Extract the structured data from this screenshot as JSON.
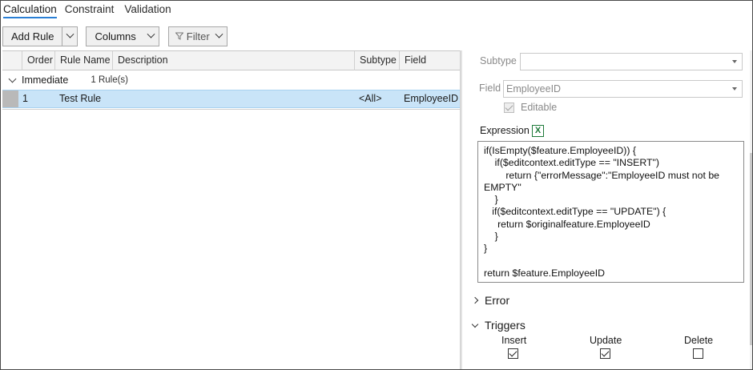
{
  "tabs": [
    {
      "label": "Calculation",
      "active": true
    },
    {
      "label": "Constraint",
      "active": false
    },
    {
      "label": "Validation",
      "active": false
    }
  ],
  "toolbar": {
    "add_rule": "Add Rule",
    "columns": "Columns",
    "filter": "Filter"
  },
  "grid": {
    "columns": [
      "Order",
      "Rule Name",
      "Description",
      "Subtype",
      "Field"
    ],
    "group": {
      "name": "Immediate",
      "count": "1 Rule(s)"
    },
    "rows": [
      {
        "order": "1",
        "rule_name": "Test Rule",
        "description": "",
        "subtype": "<All>",
        "field": "EmployeeID",
        "selected": true
      }
    ]
  },
  "details": {
    "subtype_label": "Subtype",
    "subtype_value": "",
    "field_label": "Field",
    "field_value": "EmployeeID",
    "editable_label": "Editable",
    "editable_checked": true,
    "expression_label": "Expression",
    "expression": "if(IsEmpty($feature.EmployeeID)) {\n    if($editcontext.editType == \"INSERT\")\n        return {\"errorMessage\":\"EmployeeID must not be\nEMPTY\"\n    }\n   if($editcontext.editType == \"UPDATE\") {\n     return $originalfeature.EmployeeID\n    }\n}\n\nreturn $feature.EmployeeID",
    "error_label": "Error",
    "triggers_label": "Triggers",
    "triggers": [
      {
        "label": "Insert",
        "checked": true
      },
      {
        "label": "Update",
        "checked": true
      },
      {
        "label": "Delete",
        "checked": false
      }
    ]
  },
  "colors": {
    "accent": "#2a7fd5",
    "selection": "#c9e4f8"
  }
}
